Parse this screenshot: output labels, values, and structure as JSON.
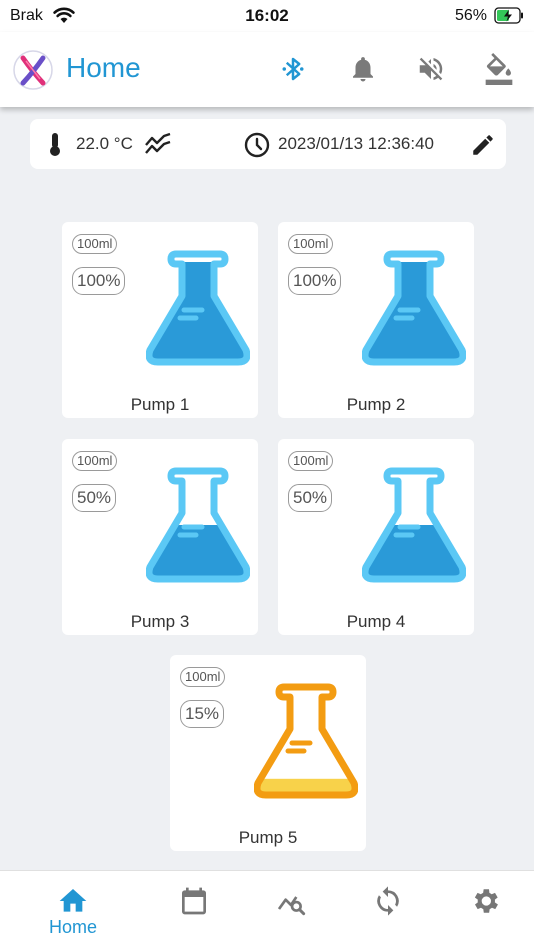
{
  "status_bar": {
    "carrier": "Brak",
    "time": "16:02",
    "battery": "56%"
  },
  "header": {
    "title": "Home",
    "icons": [
      "bluetooth-icon",
      "bell-icon",
      "volume-off-icon",
      "paint-bucket-icon"
    ],
    "accent_color": "#2196d3"
  },
  "info_bar": {
    "temperature": "22.0 °C",
    "datetime": "2023/01/13 12:36:40"
  },
  "pumps": [
    {
      "name": "Pump 1",
      "volume": "100ml",
      "percent": "100%",
      "level": 1.0,
      "color": "blue"
    },
    {
      "name": "Pump 2",
      "volume": "100ml",
      "percent": "100%",
      "level": 1.0,
      "color": "blue"
    },
    {
      "name": "Pump 3",
      "volume": "100ml",
      "percent": "50%",
      "level": 0.5,
      "color": "blue"
    },
    {
      "name": "Pump 4",
      "volume": "100ml",
      "percent": "50%",
      "level": 0.5,
      "color": "blue"
    },
    {
      "name": "Pump 5",
      "volume": "100ml",
      "percent": "15%",
      "level": 0.15,
      "color": "orange"
    }
  ],
  "colors": {
    "flask_blue_outline": "#5bc8f5",
    "flask_blue_fill": "#2a9ad8",
    "flask_orange_outline": "#f39c12",
    "flask_orange_fill": "#f8d24a",
    "nav_inactive": "#777777"
  },
  "bottom_nav": {
    "home_label": "Home",
    "items": [
      "home-icon",
      "calendar-icon",
      "analytics-icon",
      "sync-icon",
      "settings-icon"
    ]
  }
}
